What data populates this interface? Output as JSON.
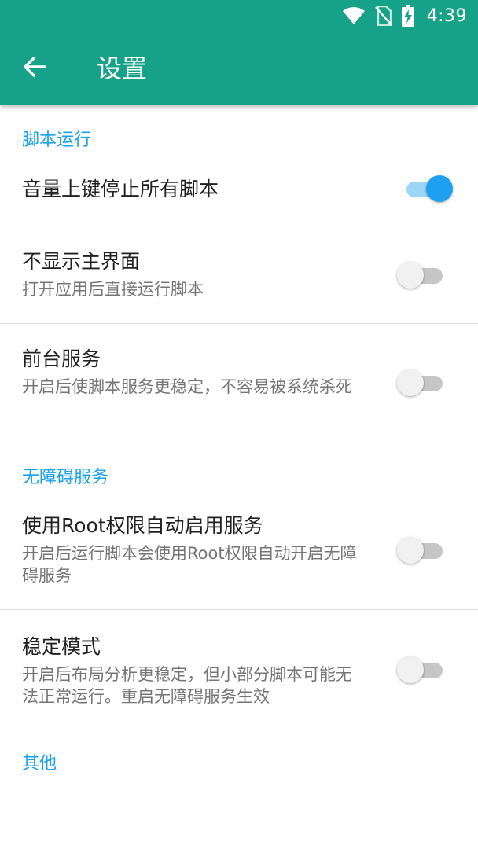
{
  "status_bar": {
    "time": "4:39",
    "icons": [
      "wifi-icon",
      "no-sim-icon",
      "battery-charging-icon"
    ]
  },
  "app_bar": {
    "back_icon": "arrow-back-icon",
    "title": "设置"
  },
  "sections": {
    "script_run": {
      "label": "脚本运行",
      "volume_stop": {
        "title": "音量上键停止所有脚本",
        "checked": true
      },
      "hide_main": {
        "title": "不显示主界面",
        "summary": "打开应用后直接运行脚本",
        "checked": false
      },
      "foreground": {
        "title": "前台服务",
        "summary": "开启后使脚本服务更稳定，不容易被系统杀死",
        "checked": false
      }
    },
    "accessibility": {
      "label": "无障碍服务",
      "root_enable": {
        "title": "使用Root权限自动启用服务",
        "summary": "开启后运行脚本会使用Root权限自动开启无障碍服务",
        "checked": false
      },
      "stable_mode": {
        "title": "稳定模式",
        "summary": "开启后布局分析更稳定，但小部分脚本可能无法正常运行。重启无障碍服务生效",
        "checked": false
      }
    },
    "other": {
      "label": "其他"
    }
  },
  "colors": {
    "primary": "#16a189",
    "accent": "#1f9ff0",
    "category_text": "#1aa3e8",
    "switch_off_thumb": "#f1f1f1",
    "switch_off_track": "#c6c6c6",
    "switch_on_track": "#9bd6f6"
  }
}
